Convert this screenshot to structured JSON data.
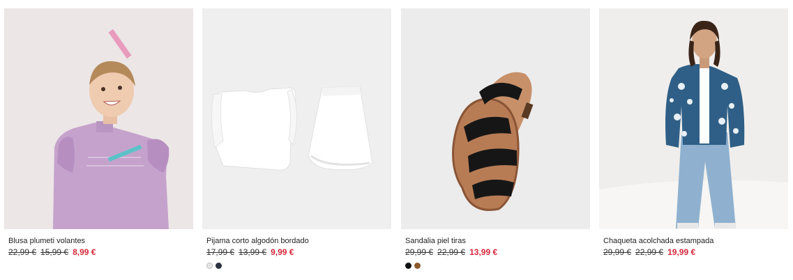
{
  "products": [
    {
      "name": "Blusa plumeti volantes",
      "price_original": "22,99 €",
      "price_previous": "15,99 €",
      "price_sale": "8,99 €",
      "image_icon": "girl-purple-blouse-photo",
      "colors": []
    },
    {
      "name": "Pijama corto algodón bordado",
      "price_original": "17,99 €",
      "price_previous": "13,99 €",
      "price_sale": "9,99 €",
      "image_icon": "white-pajama-set-photo",
      "colors": [
        "#e6e6e6",
        "#2b3140"
      ]
    },
    {
      "name": "Sandalia piel tiras",
      "price_original": "29,99 €",
      "price_previous": "22,99 €",
      "price_sale": "13,99 €",
      "image_icon": "black-leather-sandal-photo",
      "colors": [
        "#111111",
        "#8a5a2e"
      ]
    },
    {
      "name": "Chaqueta acolchada estampada",
      "price_original": "29,99 €",
      "price_previous": "22,99 €",
      "price_sale": "19,99 €",
      "image_icon": "girl-floral-jacket-photo",
      "colors": []
    }
  ],
  "sale_color": "#d4283a"
}
